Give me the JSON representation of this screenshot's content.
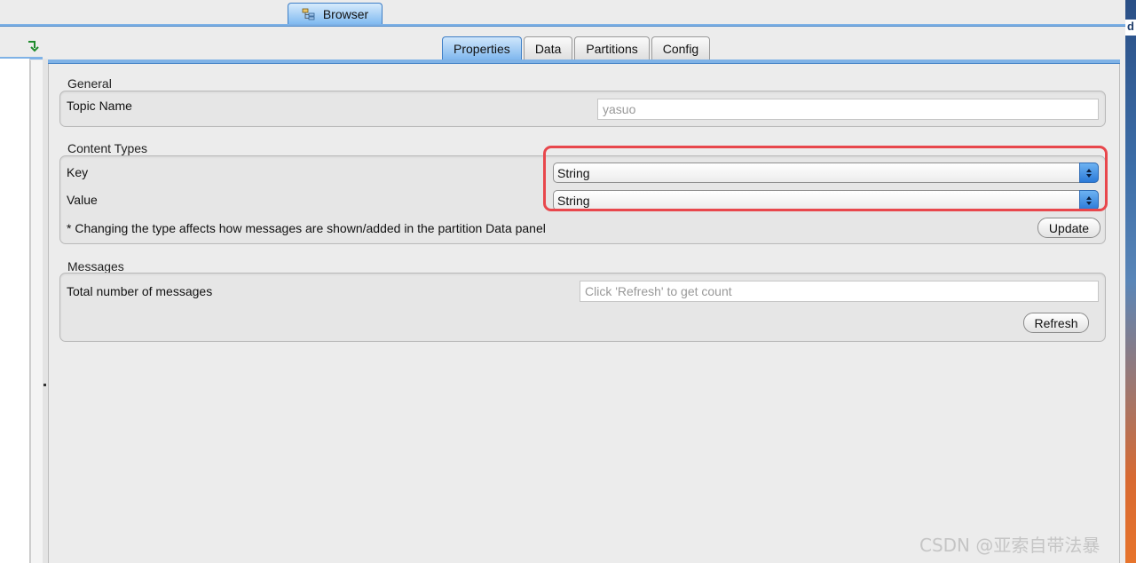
{
  "window": {
    "tab_label": "Browser",
    "tab_icon": "tree-icon",
    "right_edge_char": "d"
  },
  "tabs": [
    {
      "label": "Properties",
      "active": true
    },
    {
      "label": "Data",
      "active": false
    },
    {
      "label": "Partitions",
      "active": false
    },
    {
      "label": "Config",
      "active": false
    }
  ],
  "general": {
    "title": "General",
    "topic_name_label": "Topic Name",
    "topic_name_value": "yasuo"
  },
  "content_types": {
    "title": "Content Types",
    "key_label": "Key",
    "key_value": "String",
    "value_label": "Value",
    "value_value": "String",
    "note": "* Changing the type affects how messages are shown/added in the partition Data panel",
    "update_label": "Update"
  },
  "messages": {
    "title": "Messages",
    "total_label": "Total number of messages",
    "total_placeholder": "Click 'Refresh' to get count",
    "refresh_label": "Refresh"
  },
  "colors": {
    "highlight": "#e8474c",
    "accent": "#7fb2e6"
  },
  "watermark": "CSDN @亚索自带法暴"
}
